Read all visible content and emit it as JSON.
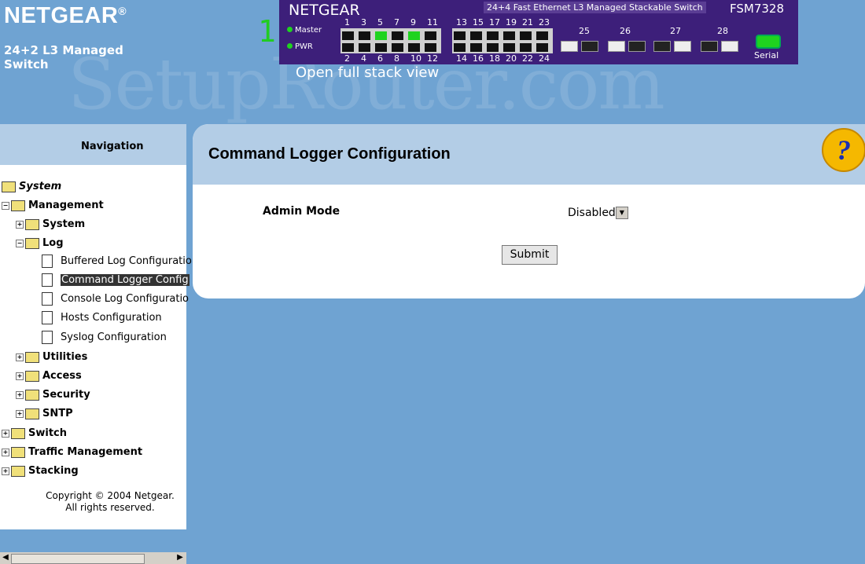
{
  "brand": {
    "logo": "NETGEAR",
    "reg": "®",
    "subtitle": "24+2 L3 Managed Switch"
  },
  "watermark": "SetupRouter.com",
  "switch_panel": {
    "brand": "NETGEAR",
    "description": "24+4 Fast Ethernet L3 Managed Stackable Switch",
    "model": "FSM7328",
    "unit_number": "1",
    "led_master": "Master",
    "led_pwr": "PWR",
    "top_ports": [
      "1",
      "3",
      "5",
      "7",
      "9",
      "11",
      "13",
      "15",
      "17",
      "19",
      "21",
      "23"
    ],
    "bottom_ports": [
      "2",
      "4",
      "6",
      "8",
      "10",
      "12",
      "14",
      "16",
      "18",
      "20",
      "22",
      "24"
    ],
    "uplink_ports": [
      "25",
      "26",
      "27",
      "28"
    ],
    "serial_label": "Serial",
    "open_stack": "Open full stack view"
  },
  "nav": {
    "header": "Navigation",
    "tree": {
      "system": "System",
      "management": "Management",
      "mgmt_system": "System",
      "log": "Log",
      "buffered": "Buffered Log Configuratio",
      "command_logger": "Command Logger Config",
      "console": "Console Log Configuratio",
      "hosts": "Hosts Configuration",
      "syslog": "Syslog Configuration",
      "utilities": "Utilities",
      "access": "Access",
      "security": "Security",
      "sntp": "SNTP",
      "switch": "Switch",
      "traffic": "Traffic Management",
      "stacking": "Stacking"
    },
    "copyright_1": "Copyright © 2004 Netgear.",
    "copyright_2": "All rights reserved."
  },
  "content": {
    "title": "Command Logger Configuration",
    "admin_mode_label": "Admin Mode",
    "admin_mode_value": "Disabled",
    "submit_label": "Submit",
    "help_symbol": "?"
  },
  "colors": {
    "background": "#6fa3d2",
    "panel_purple": "#3d1f7a",
    "header_blue": "#b3cde6",
    "led_green": "#1fd31f"
  }
}
